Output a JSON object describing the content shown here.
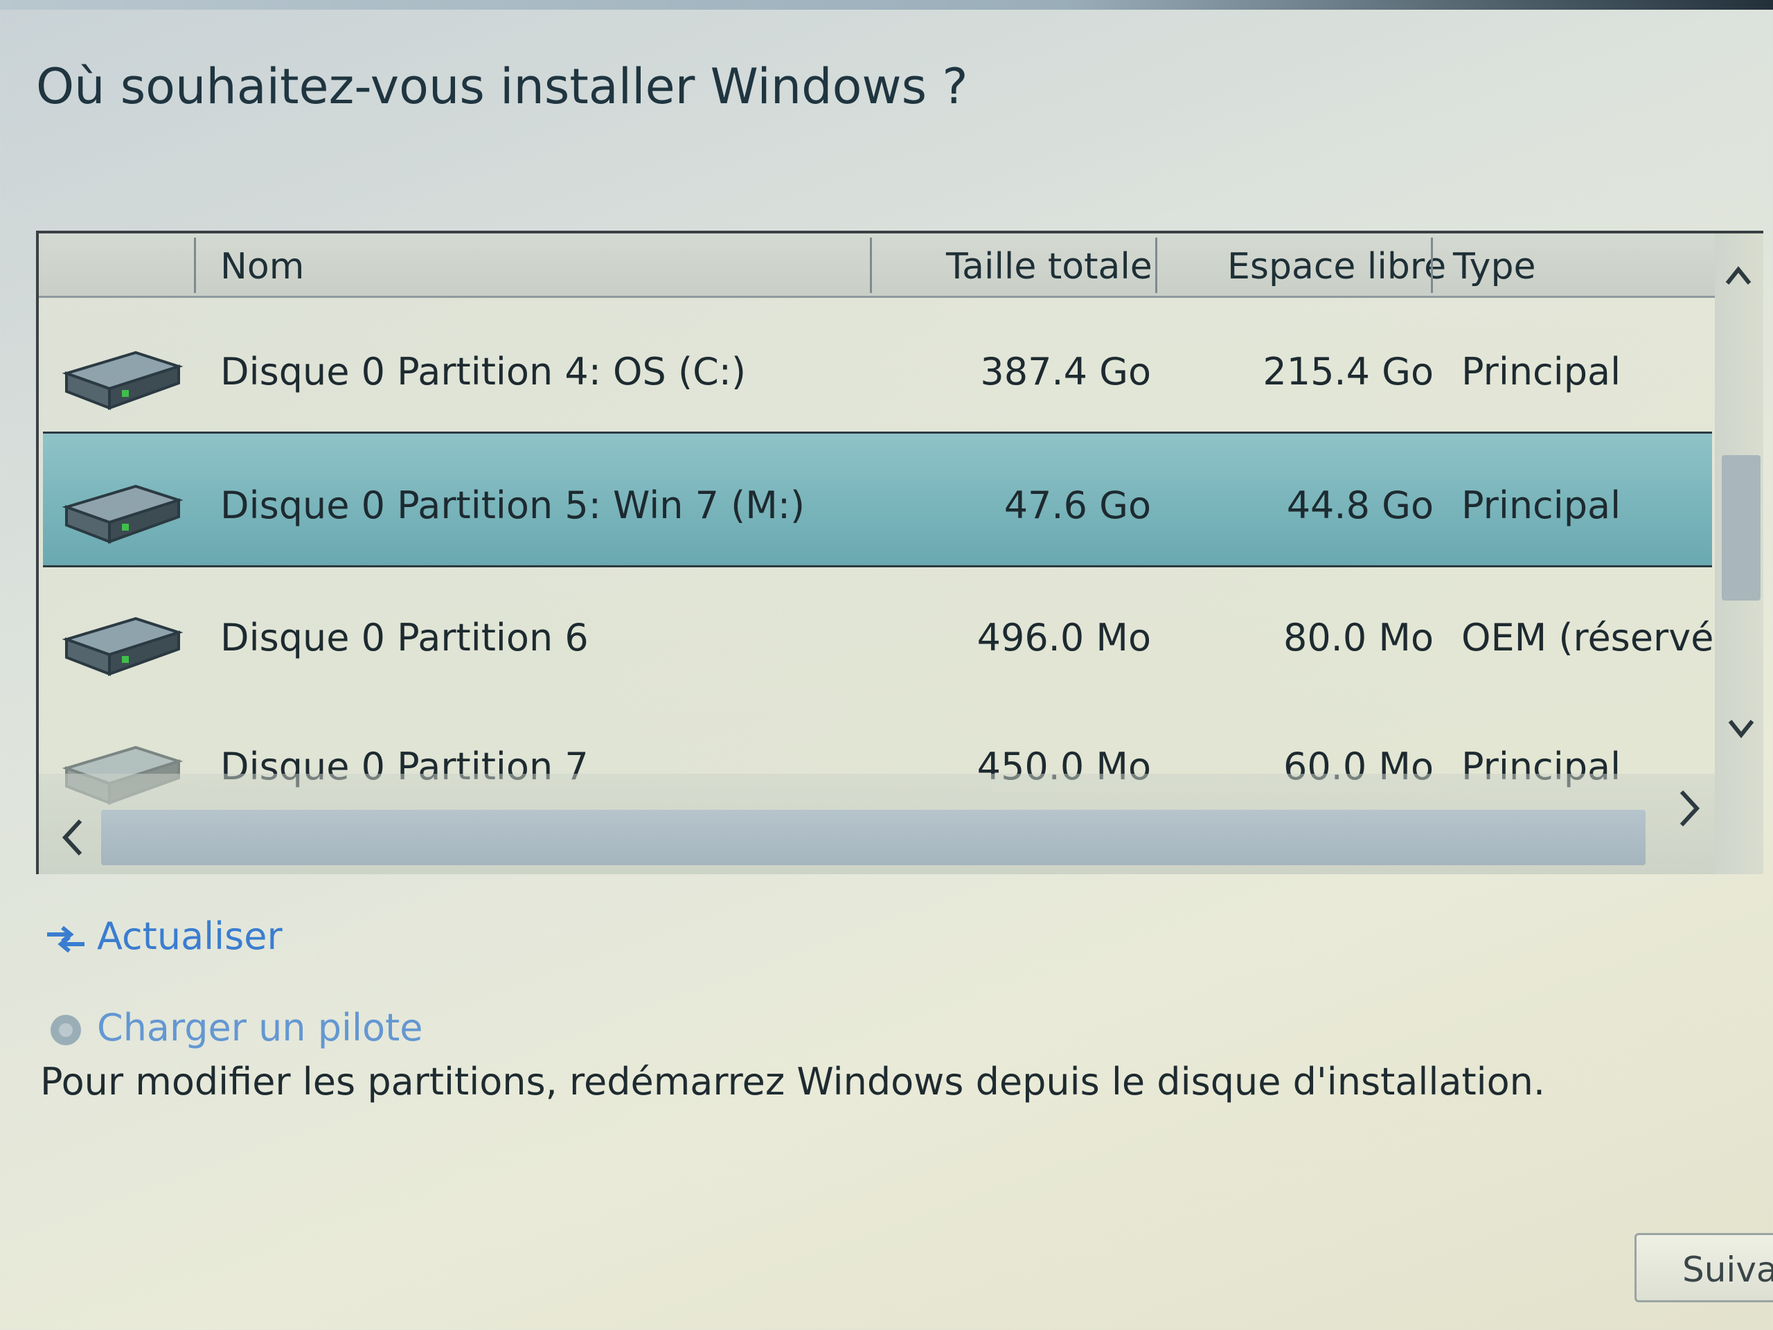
{
  "title": "Où souhaitez-vous installer Windows ?",
  "table": {
    "columns": {
      "name": "Nom",
      "total": "Taille totale",
      "free": "Espace libre",
      "type": "Type"
    },
    "rows": [
      {
        "name": "Disque 0 Partition 4: OS (C:)",
        "total": "387.4 Go",
        "free": "215.4 Go",
        "type": "Principal",
        "selected": false
      },
      {
        "name": "Disque 0 Partition 5: Win 7 (M:)",
        "total": "47.6 Go",
        "free": "44.8 Go",
        "type": "Principal",
        "selected": true
      },
      {
        "name": "Disque 0 Partition 6",
        "total": "496.0 Mo",
        "free": "80.0 Mo",
        "type": "OEM (réservé)",
        "selected": false
      },
      {
        "name": "Disque 0 Partition 7",
        "total": "450.0 Mo",
        "free": "60.0 Mo",
        "type": "Principal",
        "selected": false
      }
    ]
  },
  "links": {
    "refresh": "Actualiser",
    "load_driver": "Charger un pilote"
  },
  "note": "Pour modifier les partitions, redémarrez Windows depuis le disque d'installation.",
  "buttons": {
    "next": "Suivant"
  },
  "colors": {
    "selection": "#7db7bd",
    "link": "#3a7dd0"
  },
  "icons": {
    "disk": "hard-disk-icon",
    "refresh": "refresh-icon",
    "driver": "load-driver-icon"
  }
}
